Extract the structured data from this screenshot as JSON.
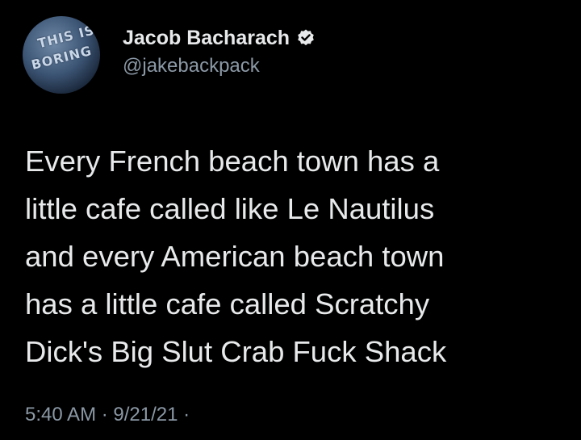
{
  "tweet": {
    "avatar_text_line1": "THIS IS",
    "avatar_text_line2": "BORING",
    "display_name": "Jacob Bacharach",
    "verified_icon": "verified-badge-icon",
    "handle": "@jakebackpack",
    "text": "Every French beach town has a\nlittle cafe called like Le Nautilus\nand every American beach town\nhas a little cafe called Scratchy\nDick's Big Slut Crab Fuck Shack",
    "time": "5:40 AM",
    "separator": " · ",
    "date": "9/21/21",
    "trailing_separator": " ·"
  },
  "colors": {
    "background": "#000000",
    "text_primary": "#e7e9ea",
    "text_secondary": "#8b98a5",
    "verified_badge": "#e7e9ea"
  }
}
